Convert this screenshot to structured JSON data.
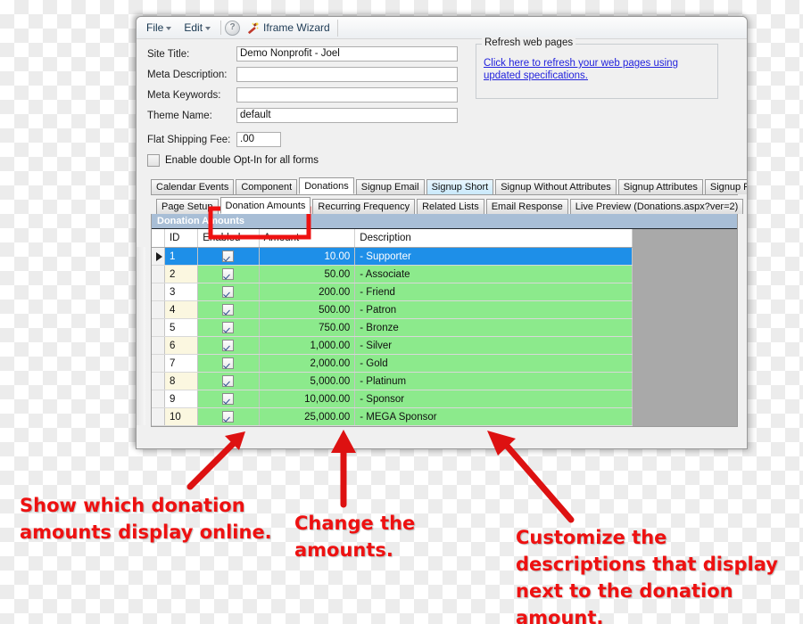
{
  "window": {
    "title": "Iframe Wizard"
  },
  "menubar": {
    "file_label": "File",
    "edit_label": "Edit",
    "help_icon_glyph": "?",
    "help_icon_name": "help-circle-icon",
    "wizard_label": "Iframe Wizard",
    "wizard_icon_name": "magic-wand-icon"
  },
  "form": {
    "fields": [
      {
        "label": "Site Title:",
        "value": "Demo Nonprofit - Joel",
        "placeholder": "",
        "width": "wide"
      },
      {
        "label": "Meta Description:",
        "value": "",
        "placeholder": "",
        "width": "wide"
      },
      {
        "label": "Meta Keywords:",
        "value": "",
        "placeholder": "",
        "width": "wide"
      },
      {
        "label": "Theme Name:",
        "value": "default",
        "placeholder": "",
        "width": "wide"
      },
      {
        "label": "Flat Shipping Fee:",
        "value": ".00",
        "placeholder": "",
        "width": "small"
      }
    ],
    "checkbox": {
      "label": "Enable double Opt-In for all forms",
      "checked": false
    }
  },
  "refresh_group": {
    "title": "Refresh web pages",
    "link_text": "Click here to refresh your web pages using updated specifications.",
    "link_color": "#2222dd"
  },
  "tabs_primary": [
    {
      "label": "Calendar Events",
      "state": "normal"
    },
    {
      "label": "Component",
      "state": "normal"
    },
    {
      "label": "Donations",
      "state": "selected"
    },
    {
      "label": "Signup Email",
      "state": "normal"
    },
    {
      "label": "Signup Short",
      "state": "hover"
    },
    {
      "label": "Signup Without Attributes",
      "state": "normal"
    },
    {
      "label": "Signup Attributes",
      "state": "normal"
    },
    {
      "label": "Signup Post",
      "state": "normal"
    }
  ],
  "tabs_secondary": [
    {
      "label": "Page Setup",
      "state": "normal"
    },
    {
      "label": "Donation Amounts",
      "state": "selected"
    },
    {
      "label": "Recurring Frequency",
      "state": "normal"
    },
    {
      "label": "Related Lists",
      "state": "normal"
    },
    {
      "label": "Email Response",
      "state": "normal"
    },
    {
      "label": "Live Preview (Donations.aspx?ver=2)",
      "state": "normal"
    }
  ],
  "grid": {
    "caption": "Donation Amounts",
    "columns": [
      "",
      "ID",
      "Enabled",
      "Amount",
      "Description"
    ],
    "rows": [
      {
        "id": "1",
        "enabled": true,
        "amount": "10.00",
        "description": "- Supporter",
        "selected": true
      },
      {
        "id": "2",
        "enabled": true,
        "amount": "50.00",
        "description": "- Associate",
        "selected": false
      },
      {
        "id": "3",
        "enabled": true,
        "amount": "200.00",
        "description": "- Friend",
        "selected": false
      },
      {
        "id": "4",
        "enabled": true,
        "amount": "500.00",
        "description": "- Patron",
        "selected": false
      },
      {
        "id": "5",
        "enabled": true,
        "amount": "750.00",
        "description": "- Bronze",
        "selected": false
      },
      {
        "id": "6",
        "enabled": true,
        "amount": "1,000.00",
        "description": "- Silver",
        "selected": false
      },
      {
        "id": "7",
        "enabled": true,
        "amount": "2,000.00",
        "description": "- Gold",
        "selected": false
      },
      {
        "id": "8",
        "enabled": true,
        "amount": "5,000.00",
        "description": "- Platinum",
        "selected": false
      },
      {
        "id": "9",
        "enabled": true,
        "amount": "10,000.00",
        "description": "- Sponsor",
        "selected": false
      },
      {
        "id": "10",
        "enabled": true,
        "amount": "25,000.00",
        "description": "- MEGA Sponsor",
        "selected": false
      }
    ]
  },
  "annotations": {
    "color": "#ee1111",
    "callout_1": "Show which donation amounts display online.",
    "callout_2": "Change the amounts.",
    "callout_3": "Customize the descriptions that display next to the donation amount."
  },
  "highlights": {
    "tab_outline_color": "#ee1111"
  }
}
